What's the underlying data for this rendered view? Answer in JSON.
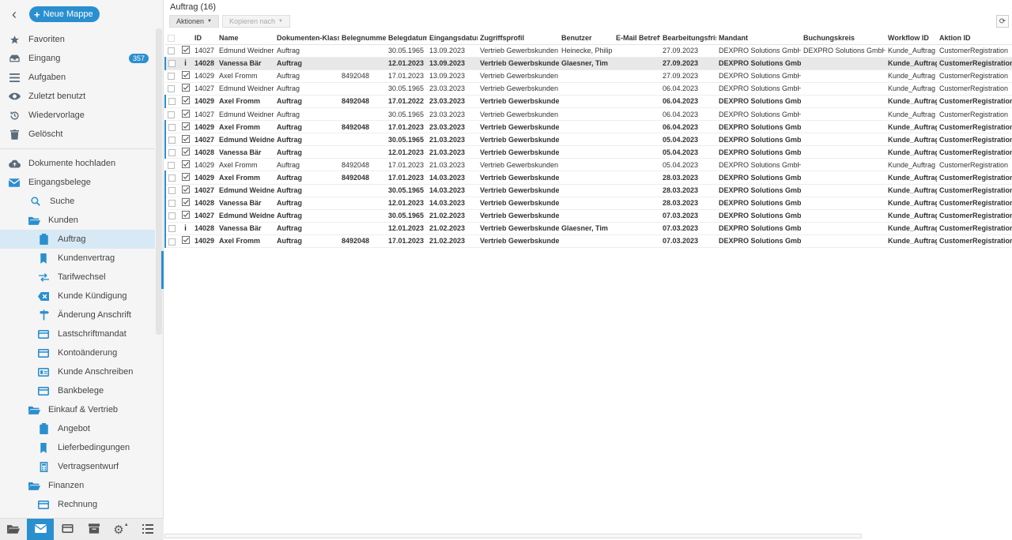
{
  "sidebar": {
    "new_folder_label": "Neue Mappe",
    "top_items": [
      {
        "label": "Favoriten",
        "icon": "star-icon"
      },
      {
        "label": "Eingang",
        "icon": "inbox-icon",
        "badge": "357"
      },
      {
        "label": "Aufgaben",
        "icon": "list-icon"
      },
      {
        "label": "Zuletzt benutzt",
        "icon": "eye-icon"
      },
      {
        "label": "Wiedervorlage",
        "icon": "history-icon"
      },
      {
        "label": "Gelöscht",
        "icon": "trash-icon"
      }
    ],
    "upload_label": "Dokumente hochladen",
    "tree": {
      "root": "Eingangsbelege",
      "search": "Suche",
      "kunden": "Kunden",
      "kunden_children": [
        "Auftrag",
        "Kundenvertrag",
        "Tarifwechsel",
        "Kunde Kündigung",
        "Änderung Anschrift",
        "Lastschriftmandat",
        "Kontoänderung",
        "Kunde Anschreiben",
        "Bankbelege"
      ],
      "einkauf": "Einkauf & Vertrieb",
      "einkauf_children": [
        "Angebot",
        "Lieferbedingungen",
        "Vertragsentwurf"
      ],
      "finanzen": "Finanzen",
      "finanzen_children": [
        "Rechnung"
      ]
    }
  },
  "main": {
    "title": "Auftrag (16)",
    "actions_label": "Aktionen",
    "copy_label": "Kopieren nach",
    "columns": [
      "",
      "",
      "ID",
      "Name",
      "Dokumenten-Klasse",
      "Belegnummer",
      "Belegdatum",
      "Eingangsdatum",
      "Zugriffsprofil",
      "Benutzer",
      "E-Mail Betreff",
      "Bearbeitungsfrist",
      "Mandant",
      "Buchungskreis",
      "Workflow ID",
      "Aktion ID"
    ],
    "rows": [
      {
        "s": "check",
        "id": "14027",
        "name": "Edmund Weidner",
        "cls": "Auftrag",
        "num": "",
        "bdate": "30.05.1965",
        "edate": "13.09.2023",
        "profil": "Vertrieb Gewerbskunden",
        "user": "Heinecke, Philip",
        "mail": "",
        "frist": "27.09.2023",
        "mandant": "DEXPRO Solutions GmbH",
        "bk": "DEXPRO Solutions GmbH",
        "wf": "Kunde_Auftrag",
        "aktion": "CustomerRegistration",
        "bold": false,
        "sel": false,
        "mark": false
      },
      {
        "s": "info",
        "id": "14028",
        "name": "Vanessa Bär",
        "cls": "Auftrag",
        "num": "",
        "bdate": "12.01.2023",
        "edate": "13.09.2023",
        "profil": "Vertrieb Gewerbskunden",
        "user": "Glaesner, Tim",
        "mail": "",
        "frist": "27.09.2023",
        "mandant": "DEXPRO Solutions GmbH",
        "bk": "",
        "wf": "Kunde_Auftrag",
        "aktion": "CustomerRegistration",
        "bold": true,
        "sel": true,
        "mark": true
      },
      {
        "s": "check",
        "id": "14029",
        "name": "Axel Fromm",
        "cls": "Auftrag",
        "num": "8492048",
        "bdate": "17.01.2023",
        "edate": "13.09.2023",
        "profil": "Vertrieb Gewerbskunden",
        "user": "",
        "mail": "",
        "frist": "27.09.2023",
        "mandant": "DEXPRO Solutions GmbH",
        "bk": "",
        "wf": "Kunde_Auftrag",
        "aktion": "CustomerRegistration",
        "bold": false,
        "sel": false,
        "mark": false
      },
      {
        "s": "check",
        "id": "14027",
        "name": "Edmund Weidner",
        "cls": "Auftrag",
        "num": "",
        "bdate": "30.05.1965",
        "edate": "23.03.2023",
        "profil": "Vertrieb Gewerbskunden",
        "user": "",
        "mail": "",
        "frist": "06.04.2023",
        "mandant": "DEXPRO Solutions GmbH",
        "bk": "",
        "wf": "Kunde_Auftrag",
        "aktion": "CustomerRegistration",
        "bold": false,
        "sel": false,
        "mark": false
      },
      {
        "s": "check",
        "id": "14029",
        "name": "Axel Fromm",
        "cls": "Auftrag",
        "num": "8492048",
        "bdate": "17.01.2022",
        "edate": "23.03.2023",
        "profil": "Vertrieb Gewerbskunden",
        "user": "",
        "mail": "",
        "frist": "06.04.2023",
        "mandant": "DEXPRO Solutions GmbH",
        "bk": "",
        "wf": "Kunde_Auftrag",
        "aktion": "CustomerRegistration",
        "bold": true,
        "sel": false,
        "mark": true
      },
      {
        "s": "check",
        "id": "14027",
        "name": "Edmund Weidner",
        "cls": "Auftrag",
        "num": "",
        "bdate": "30.05.1965",
        "edate": "23.03.2023",
        "profil": "Vertrieb Gewerbskunden",
        "user": "",
        "mail": "",
        "frist": "06.04.2023",
        "mandant": "DEXPRO Solutions GmbH",
        "bk": "",
        "wf": "Kunde_Auftrag",
        "aktion": "CustomerRegistration",
        "bold": false,
        "sel": false,
        "mark": false
      },
      {
        "s": "check",
        "id": "14029",
        "name": "Axel Fromm",
        "cls": "Auftrag",
        "num": "8492048",
        "bdate": "17.01.2023",
        "edate": "23.03.2023",
        "profil": "Vertrieb Gewerbskunden",
        "user": "",
        "mail": "",
        "frist": "06.04.2023",
        "mandant": "DEXPRO Solutions GmbH",
        "bk": "",
        "wf": "Kunde_Auftrag",
        "aktion": "CustomerRegistration",
        "bold": true,
        "sel": false,
        "mark": true
      },
      {
        "s": "check",
        "id": "14027",
        "name": "Edmund Weidner",
        "cls": "Auftrag",
        "num": "",
        "bdate": "30.05.1965",
        "edate": "21.03.2023",
        "profil": "Vertrieb Gewerbskunden",
        "user": "",
        "mail": "",
        "frist": "05.04.2023",
        "mandant": "DEXPRO Solutions GmbH",
        "bk": "",
        "wf": "Kunde_Auftrag",
        "aktion": "CustomerRegistration",
        "bold": true,
        "sel": false,
        "mark": true
      },
      {
        "s": "check",
        "id": "14028",
        "name": "Vanessa Bär",
        "cls": "Auftrag",
        "num": "",
        "bdate": "12.01.2023",
        "edate": "21.03.2023",
        "profil": "Vertrieb Gewerbskunden",
        "user": "",
        "mail": "",
        "frist": "05.04.2023",
        "mandant": "DEXPRO Solutions GmbH",
        "bk": "",
        "wf": "Kunde_Auftrag",
        "aktion": "CustomerRegistration",
        "bold": true,
        "sel": false,
        "mark": true
      },
      {
        "s": "check",
        "id": "14029",
        "name": "Axel Fromm",
        "cls": "Auftrag",
        "num": "8492048",
        "bdate": "17.01.2023",
        "edate": "21.03.2023",
        "profil": "Vertrieb Gewerbskunden",
        "user": "",
        "mail": "",
        "frist": "05.04.2023",
        "mandant": "DEXPRO Solutions GmbH",
        "bk": "",
        "wf": "Kunde_Auftrag",
        "aktion": "CustomerRegistration",
        "bold": false,
        "sel": false,
        "mark": false
      },
      {
        "s": "check",
        "id": "14029",
        "name": "Axel Fromm",
        "cls": "Auftrag",
        "num": "8492048",
        "bdate": "17.01.2023",
        "edate": "14.03.2023",
        "profil": "Vertrieb Gewerbskunden",
        "user": "",
        "mail": "",
        "frist": "28.03.2023",
        "mandant": "DEXPRO Solutions GmbH",
        "bk": "",
        "wf": "Kunde_Auftrag",
        "aktion": "CustomerRegistration",
        "bold": true,
        "sel": false,
        "mark": true
      },
      {
        "s": "check",
        "id": "14027",
        "name": "Edmund Weidner",
        "cls": "Auftrag",
        "num": "",
        "bdate": "30.05.1965",
        "edate": "14.03.2023",
        "profil": "Vertrieb Gewerbskunden",
        "user": "",
        "mail": "",
        "frist": "28.03.2023",
        "mandant": "DEXPRO Solutions GmbH",
        "bk": "",
        "wf": "Kunde_Auftrag",
        "aktion": "CustomerRegistration",
        "bold": true,
        "sel": false,
        "mark": true
      },
      {
        "s": "check",
        "id": "14028",
        "name": "Vanessa Bär",
        "cls": "Auftrag",
        "num": "",
        "bdate": "12.01.2023",
        "edate": "14.03.2023",
        "profil": "Vertrieb Gewerbskunden",
        "user": "",
        "mail": "",
        "frist": "28.03.2023",
        "mandant": "DEXPRO Solutions GmbH",
        "bk": "",
        "wf": "Kunde_Auftrag",
        "aktion": "CustomerRegistration",
        "bold": true,
        "sel": false,
        "mark": true
      },
      {
        "s": "check",
        "id": "14027",
        "name": "Edmund Weidner",
        "cls": "Auftrag",
        "num": "",
        "bdate": "30.05.1965",
        "edate": "21.02.2023",
        "profil": "Vertrieb Gewerbskunden",
        "user": "",
        "mail": "",
        "frist": "07.03.2023",
        "mandant": "DEXPRO Solutions GmbH",
        "bk": "",
        "wf": "Kunde_Auftrag",
        "aktion": "CustomerRegistration",
        "bold": true,
        "sel": false,
        "mark": true
      },
      {
        "s": "info",
        "id": "14028",
        "name": "Vanessa Bär",
        "cls": "Auftrag",
        "num": "",
        "bdate": "12.01.2023",
        "edate": "21.02.2023",
        "profil": "Vertrieb Gewerbskunden",
        "user": "Glaesner, Tim",
        "mail": "",
        "frist": "07.03.2023",
        "mandant": "DEXPRO Solutions GmbH",
        "bk": "",
        "wf": "Kunde_Auftrag",
        "aktion": "CustomerRegistration",
        "bold": true,
        "sel": false,
        "mark": true
      },
      {
        "s": "check",
        "id": "14029",
        "name": "Axel Fromm",
        "cls": "Auftrag",
        "num": "8492048",
        "bdate": "17.01.2023",
        "edate": "21.02.2023",
        "profil": "Vertrieb Gewerbskunden",
        "user": "",
        "mail": "",
        "frist": "07.03.2023",
        "mandant": "DEXPRO Solutions GmbH",
        "bk": "",
        "wf": "Kunde_Auftrag",
        "aktion": "CustomerRegistration",
        "bold": true,
        "sel": false,
        "mark": true
      }
    ]
  },
  "colors": {
    "accent": "#2a8fcf"
  }
}
